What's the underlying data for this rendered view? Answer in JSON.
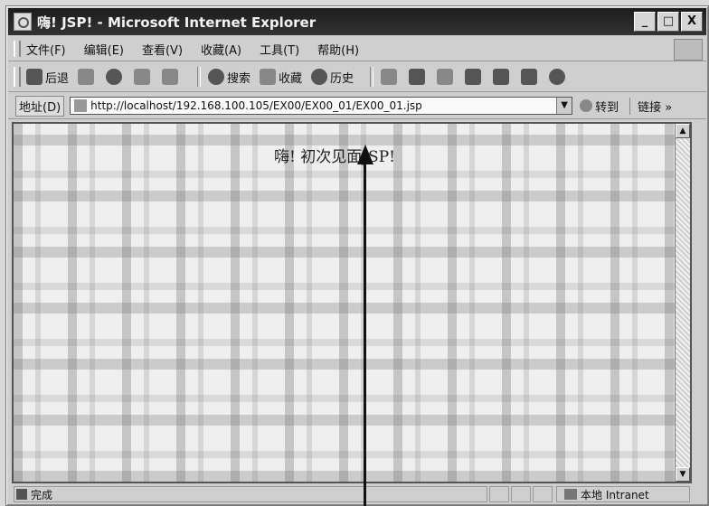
{
  "window": {
    "title": "嗨! JSP! - Microsoft Internet Explorer",
    "controls": [
      "_",
      "□",
      "X"
    ]
  },
  "menu": {
    "items": [
      "文件(F)",
      "编辑(E)",
      "查看(V)",
      "收藏(A)",
      "工具(T)",
      "帮助(H)"
    ]
  },
  "toolbar": {
    "back_label": "后退",
    "search_label": "搜索",
    "favorites_label": "收藏",
    "history_label": "历史"
  },
  "address": {
    "label": "地址(D)",
    "url": "http://localhost/192.168.100.105/EX00/EX00_01/EX00_01.jsp",
    "go_label": "转到",
    "links_label": "链接 »"
  },
  "content": {
    "greeting": "嗨! 初次见面JSP!"
  },
  "status": {
    "text": "完成",
    "zone": "本地 Intranet"
  }
}
